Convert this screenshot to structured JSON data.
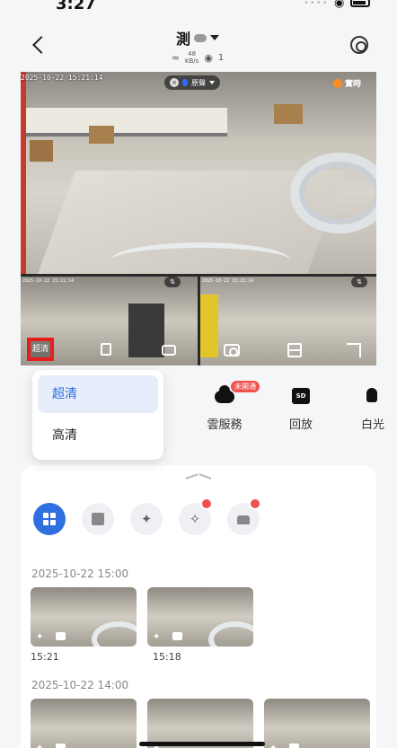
{
  "status_bar": {
    "time": "3:27"
  },
  "header": {
    "title": "測",
    "speed_value": "48",
    "speed_unit": "KB/s",
    "viewers": "1"
  },
  "video": {
    "timestamp": "2025-10-22 15:21:14",
    "audio_label": "原聲",
    "realtime_label": "實時",
    "sub_timestamp": "2025-10-22 15:21:14",
    "quality_label": "超清"
  },
  "quality_menu": {
    "options": [
      "超清",
      "高清"
    ]
  },
  "functions": {
    "cloud_label": "雲服務",
    "cloud_badge": "未開通",
    "playback_label": "回放",
    "playback_icon_text": "SD",
    "light_label": "白光"
  },
  "events": {
    "groups": [
      {
        "date": "2025-10-22 15:00",
        "times": [
          "15:21",
          "15:18"
        ]
      },
      {
        "date": "2025-10-22 14:00",
        "times": [
          "",
          "",
          ""
        ]
      }
    ]
  },
  "colors": {
    "accent": "#2f6fdf",
    "highlight": "#e51d1d",
    "badge": "#f05252"
  }
}
